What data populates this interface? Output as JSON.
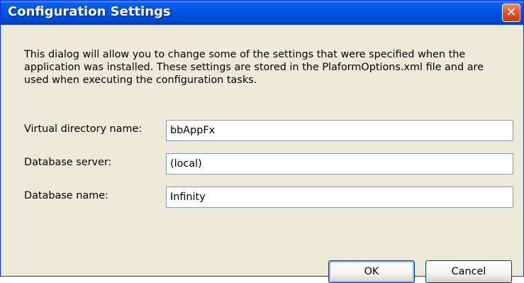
{
  "window": {
    "title": "Configuration Settings",
    "close_glyph": "✕"
  },
  "description": "This dialog will allow you to change some of the settings that were specified when the application was installed.  These settings are stored in the PlaformOptions.xml file and are used when executing the configuration tasks.",
  "fields": [
    {
      "label": "Virtual directory name:",
      "value": "bbAppFx"
    },
    {
      "label": "Database server:",
      "value": "(local)"
    },
    {
      "label": "Database name:",
      "value": "Infinity"
    }
  ],
  "buttons": {
    "ok": "OK",
    "cancel": "Cancel"
  },
  "colors": {
    "titlebar": "#0054e3",
    "dialog_bg": "#ece9d8",
    "close_button": "#e0542b",
    "input_border": "#7f9db9"
  }
}
